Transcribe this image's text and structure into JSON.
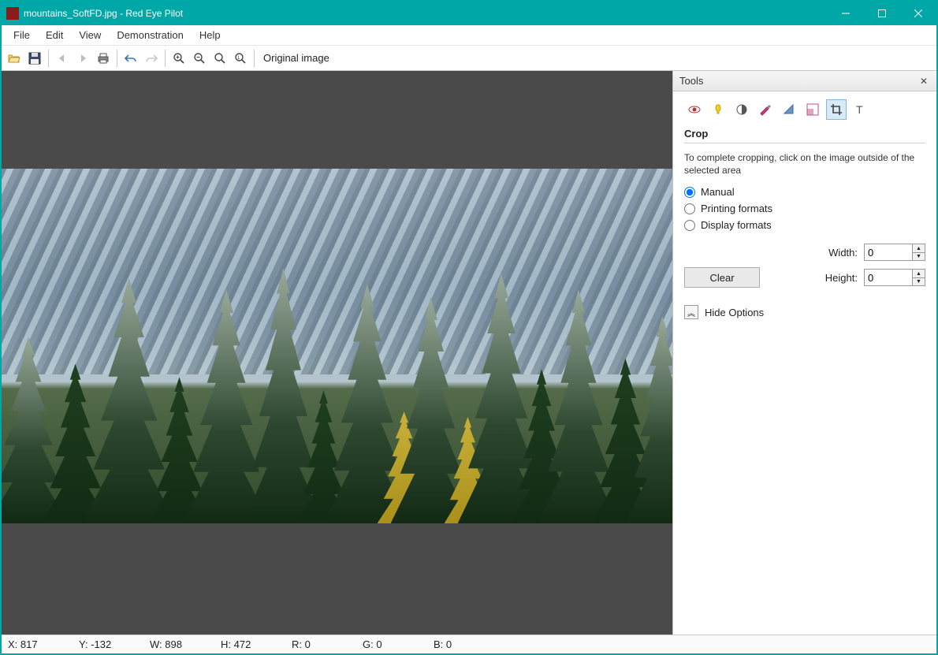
{
  "titlebar": {
    "title": "mountains_SoftFD.jpg - Red Eye Pilot"
  },
  "menu": {
    "file": "File",
    "edit": "Edit",
    "view": "View",
    "demonstration": "Demonstration",
    "help": "Help"
  },
  "toolbar": {
    "label": "Original image"
  },
  "tools": {
    "panel_title": "Tools",
    "section_title": "Crop",
    "description": "To complete cropping, click on the image outside of the selected area",
    "radio_manual": "Manual",
    "radio_printing": "Printing formats",
    "radio_display": "Display formats",
    "width_label": "Width:",
    "height_label": "Height:",
    "width_value": "0",
    "height_value": "0",
    "clear_btn": "Clear",
    "hide_options": "Hide Options"
  },
  "status": {
    "x_label": "X:",
    "x_val": "817",
    "y_label": "Y:",
    "y_val": "-132",
    "w_label": "W:",
    "w_val": "898",
    "h_label": "H:",
    "h_val": "472",
    "r_label": "R:",
    "r_val": "0",
    "g_label": "G:",
    "g_val": "0",
    "b_label": "B:",
    "b_val": "0"
  }
}
